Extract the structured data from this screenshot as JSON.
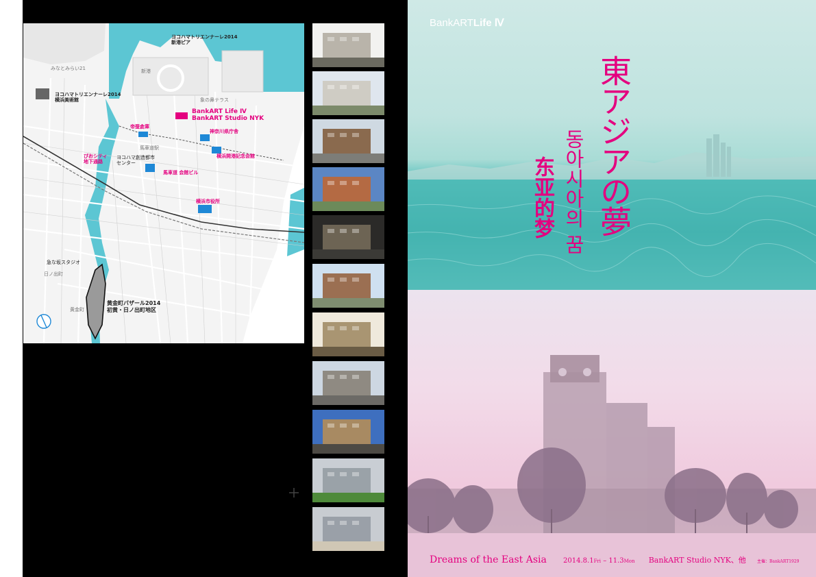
{
  "map": {
    "labels": {
      "triennale_pier": "ヨコハマトリエンナーレ2014\n新港ピア",
      "minato_mirai": "みなとみらい21",
      "triennale_museum": "ヨコハマトリエンナーレ2014\n横浜美術館",
      "bankart_life": "BankART Life Ⅳ",
      "bankart_nyk": "BankART Studio NYK",
      "teisan": "帝蚕倉庫",
      "kanagawa_pref": "神奈川県庁舎",
      "kaikou": "横浜開港記念会館",
      "pioshiti": "ぴおシティ\n地下通路",
      "yokohama_center": "ヨコハマ創造都市\nセンター",
      "basha": "馬車道 会館ビル",
      "city_hall": "横浜市役所",
      "kyu_studio": "急な坂スタジオ",
      "koganecho": "黄金町バザール2014\n初黄・日ノ出町地区",
      "zou_terrace": "象の鼻テラス",
      "shinko": "新港",
      "bashamichi_st": "馬車道駅",
      "hinodecho": "日ノ出町",
      "koganecho_st": "黄金町"
    }
  },
  "thumbnails": [
    {
      "name": "thumb-warehouse-riverside",
      "sky": "#f2f2f0",
      "building": "#b9b4aa",
      "ground": "#6b6a60"
    },
    {
      "name": "thumb-white-apartment",
      "sky": "#dfe6ee",
      "building": "#cfccc4",
      "ground": "#7c8a6a"
    },
    {
      "name": "thumb-brick-building",
      "sky": "#cfd9e2",
      "building": "#8a6a4e",
      "ground": "#7d7d78"
    },
    {
      "name": "thumb-clock-tower",
      "sky": "#5b86c4",
      "building": "#b46a43",
      "ground": "#6c8a5a"
    },
    {
      "name": "thumb-arched-interior",
      "sky": "#2b2a28",
      "building": "#6d6454",
      "ground": "#3b3a36"
    },
    {
      "name": "thumb-prefectural-office",
      "sky": "#cfe0f0",
      "building": "#9b6f52",
      "ground": "#7f8d70"
    },
    {
      "name": "thumb-church-interior",
      "sky": "#efe9dc",
      "building": "#a99572",
      "ground": "#6a5c45"
    },
    {
      "name": "thumb-old-commercial",
      "sky": "#cdd7e2",
      "building": "#8f8a82",
      "ground": "#6c6a66"
    },
    {
      "name": "thumb-concrete-frame",
      "sky": "#3e6fbf",
      "building": "#a88a62",
      "ground": "#4d4a44"
    },
    {
      "name": "thumb-foggy-field",
      "sky": "#c9ced4",
      "building": "#9aa2a8",
      "ground": "#4e8a3a"
    },
    {
      "name": "thumb-underground-passage",
      "sky": "#c8ccd1",
      "building": "#9aa0a8",
      "ground": "#d0c7b5"
    }
  ],
  "poster": {
    "brand": "BankART",
    "brand_strong": "Life Ⅳ",
    "title_jp": "東アジアの夢",
    "title_kr": "동아시아의 꿈",
    "title_cn": "东亚的梦",
    "footer_en": "Dreams of the East Asia",
    "footer_date": "2014.8.1",
    "footer_day1": "Fri",
    "footer_dash": " – ",
    "footer_date2": "11.3",
    "footer_day2": "Mon",
    "footer_venue": "BankART Studio NYK、他",
    "footer_org": "主催：BankART1929",
    "colors": {
      "accent": "#e4007f",
      "sea": "#3fb0ad"
    }
  }
}
